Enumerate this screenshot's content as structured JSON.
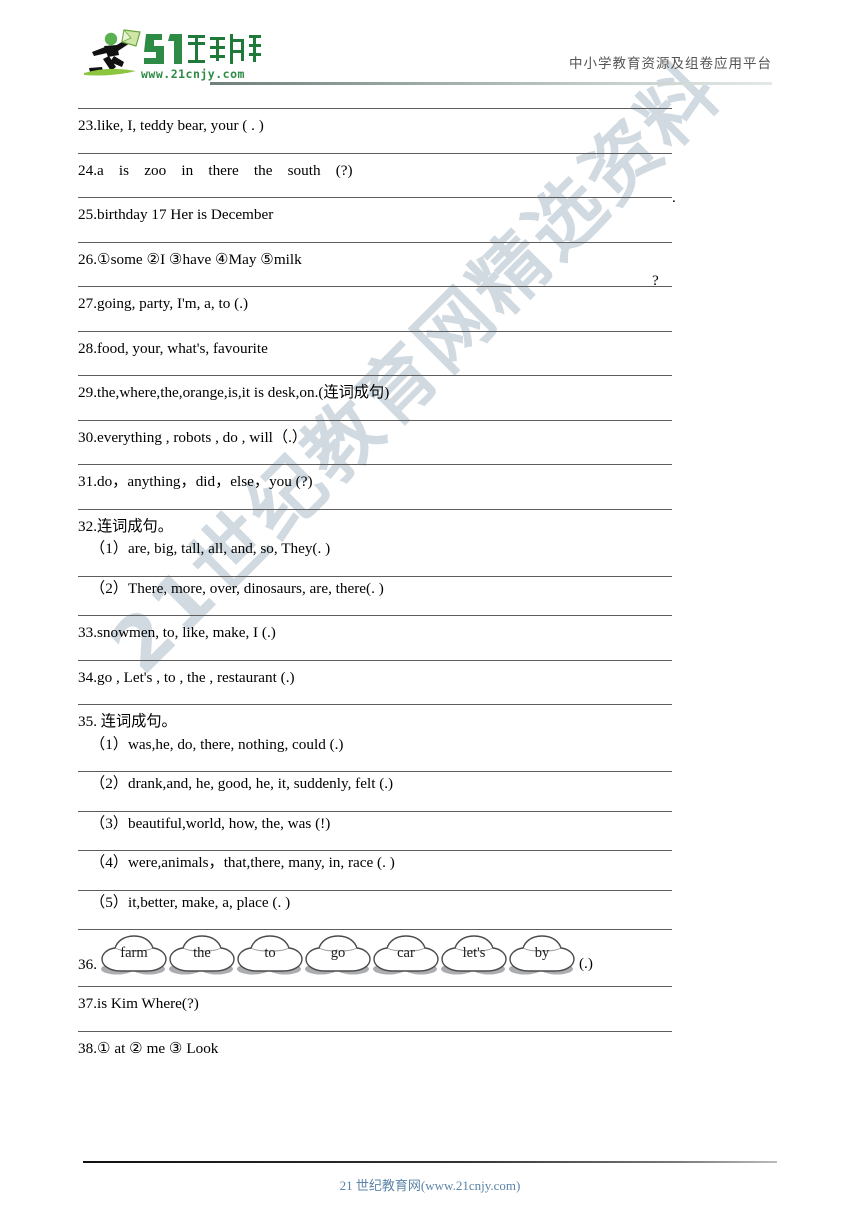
{
  "header": {
    "logo": {
      "brand_number": "21",
      "brand_cn": "世纪教育",
      "brand_url": "www.21cnjy.com",
      "icon": "running-person-with-book-icon",
      "green": "#3f9c45",
      "dark_green": "#1f7a3a",
      "light_green": "#8cc63f"
    },
    "tagline": "中小学教育资源及组卷应用平台"
  },
  "watermark": {
    "text": "21世纪教育网精选资料",
    "color": "#cfd9e0"
  },
  "questions": [
    {
      "id": "q23",
      "type": "simple",
      "text": "23.like, I, teddy bear, your ( . )",
      "endmark": ""
    },
    {
      "id": "q24",
      "type": "simple",
      "text": "24.a    is    zoo    in    there    the    south    (?)",
      "endmark": ""
    },
    {
      "id": "q25",
      "type": "simple",
      "text": "25.birthday 17 Her is December",
      "endmark": "."
    },
    {
      "id": "q26",
      "type": "simple",
      "text": "26.①some ②I ③have ④May ⑤milk",
      "endmark": "?"
    },
    {
      "id": "q27",
      "type": "simple",
      "text": "27.going, party, I'm, a, to (.)",
      "endmark": ""
    },
    {
      "id": "q28",
      "type": "simple",
      "text": "28.food, your, what's, favourite",
      "endmark": ""
    },
    {
      "id": "q29",
      "type": "simple",
      "text": "29.the,where,the,orange,is,it is desk,on.(连词成句)",
      "endmark": ""
    },
    {
      "id": "q30",
      "type": "simple",
      "text": "30.everything , robots , do , will（.）",
      "endmark": ""
    },
    {
      "id": "q31",
      "type": "simple",
      "text": "31.do，anything，did，else，you (?)",
      "endmark": ""
    },
    {
      "id": "q32",
      "type": "grouped",
      "head": "32.连词成句。",
      "subs": [
        "（1）are, big, tall, all, and, so, They(. )",
        "（2）There, more, over, dinosaurs, are, there(. )"
      ]
    },
    {
      "id": "q33",
      "type": "simple",
      "text": "33.snowmen, to, like, make, I (.)",
      "endmark": ""
    },
    {
      "id": "q34",
      "type": "simple",
      "text": "34.go , Let's , to , the , restaurant (.)",
      "endmark": ""
    },
    {
      "id": "q35",
      "type": "grouped",
      "head": "35.  连词成句。",
      "subs": [
        "（1）was,he, do, there, nothing, could (.)",
        "（2）drank,and, he, good, he, it, suddenly, felt (.)",
        "（3）beautiful,world, how, the, was (!)",
        "（4）were,animals，that,there, many, in, race (. )",
        "（5）it,better, make, a, place (. )"
      ]
    },
    {
      "id": "q36",
      "type": "balloons",
      "prefix": "36.",
      "words": [
        "farm",
        "the",
        "to",
        "go",
        "car",
        "let's",
        "by"
      ],
      "suffix": "(.)"
    },
    {
      "id": "q37",
      "type": "simple",
      "text": "37.is Kim Where(?)",
      "endmark": ""
    },
    {
      "id": "q38",
      "type": "simple",
      "text": "38.① at ② me ③ Look",
      "endmark": ""
    }
  ],
  "footer": {
    "text": "21 世纪教育网(www.21cnjy.com)",
    "color": "#5b84a8"
  }
}
